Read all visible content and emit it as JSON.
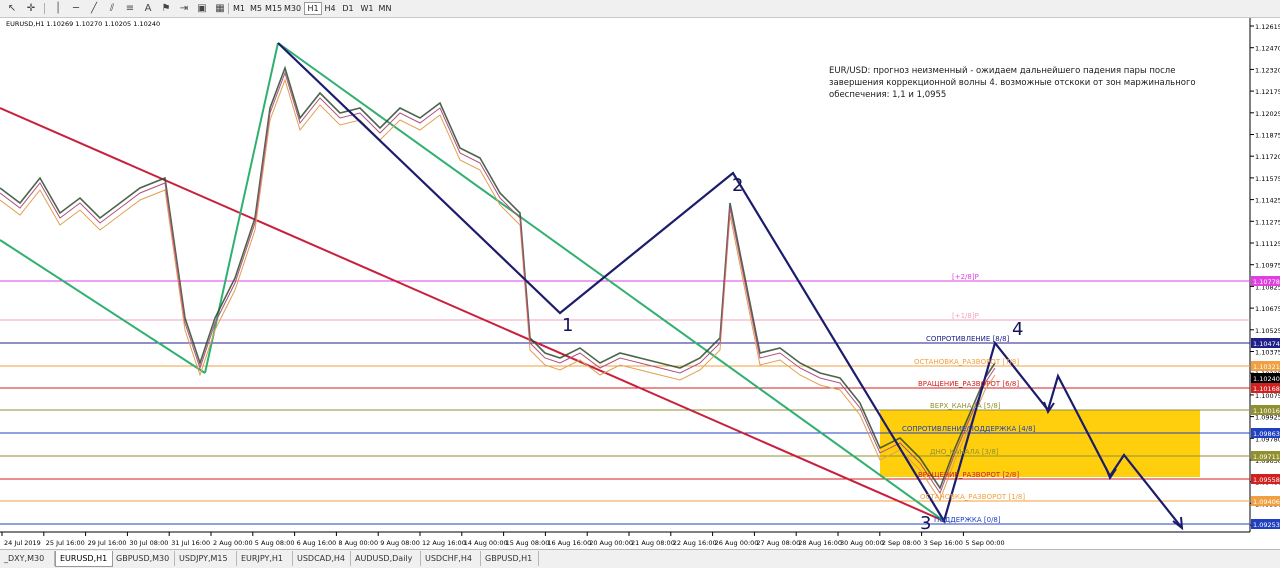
{
  "toolbar": {
    "timeframes": [
      "M1",
      "M5",
      "M15",
      "M30",
      "H1",
      "H4",
      "D1",
      "W1",
      "MN"
    ],
    "active_timeframe": "H1"
  },
  "chart": {
    "header": "EURUSD,H1  1.10269 1.10270 1.10205 1.10240",
    "annotation": "EUR/USD: прогноз неизменный - ожидаем дальнейшего падения пары после завершения коррекционной волны 4. возможные отскоки от зон маржинального обеспечения: 1,1 и 1,0955",
    "wave_labels": [
      "1",
      "2",
      "3",
      "4"
    ],
    "price_ticks": [
      "1.12615",
      "1.12470",
      "1.12320",
      "1.12175",
      "1.12025",
      "1.11875",
      "1.11720",
      "1.11575",
      "1.11425",
      "1.11275",
      "1.11125",
      "1.10975",
      "1.10825",
      "1.10675",
      "1.10525",
      "1.10375",
      "1.10225",
      "1.10075",
      "1.09925",
      "1.09780",
      "1.09630",
      "1.09480",
      "1.09330",
      "1.09180"
    ],
    "time_ticks": [
      "24 Jul 2019",
      "25 Jul 16:00",
      "29 Jul 16:00",
      "30 Jul 08:00",
      "31 Jul 16:00",
      "2 Aug 00:00",
      "5 Aug 08:00",
      "6 Aug 16:00",
      "8 Aug 00:00",
      "9 Aug 08:00",
      "12 Aug 16:00",
      "14 Aug 00:00",
      "15 Aug 08:00",
      "16 Aug 16:00",
      "20 Aug 00:00",
      "21 Aug 08:00",
      "22 Aug 16:00",
      "26 Aug 00:00",
      "27 Aug 08:00",
      "28 Aug 16:00",
      "30 Aug 00:00",
      "2 Sep 08:00",
      "3 Sep 16:00",
      "5 Sep 00:00"
    ],
    "level_badges": [
      {
        "text": "1.10778",
        "bg": "#e040e0"
      },
      {
        "text": "1.10474",
        "bg": "#20208a"
      },
      {
        "text": "1.10321",
        "bg": "#f0a040"
      },
      {
        "text": "1.10240",
        "bg": "#000000"
      },
      {
        "text": "1.10168",
        "bg": "#d02020"
      },
      {
        "text": "1.10016",
        "bg": "#909030"
      },
      {
        "text": "1.09863",
        "bg": "#2040c0"
      },
      {
        "text": "1.09711",
        "bg": "#909030"
      },
      {
        "text": "1.09558",
        "bg": "#d02020"
      },
      {
        "text": "1.09406",
        "bg": "#f0a040"
      },
      {
        "text": "1.09253",
        "bg": "#2040c0"
      }
    ],
    "murray_labels": [
      {
        "text": "[+2/8]P",
        "color": "#e040e0"
      },
      {
        "text": "[+1/8]P",
        "color": "#f4a0c0"
      },
      {
        "text": "СОПРОТИВЛЕНИЕ [8/8]",
        "color": "#20208a"
      },
      {
        "text": "ОСТАНОВКА_РАЗВОРОТ [7/8]",
        "color": "#f0a040"
      },
      {
        "text": "ВРАЩЕНИЕ_РАЗВОРОТ [6/8]",
        "color": "#d02020"
      },
      {
        "text": "ВЕРХ_КАНАЛА [5/8]",
        "color": "#909030"
      },
      {
        "text": "СОПРОТИВЛЕНИЕ/ПОДДЕРЖКА [4/8]",
        "color": "#2040c0"
      },
      {
        "text": "ДНО_КАНАЛА [3/8]",
        "color": "#909030"
      },
      {
        "text": "ВРАЩЕНИЕ_РАЗВОРОТ [2/8]",
        "color": "#d02020"
      },
      {
        "text": "ОСТАНОВКА_РАЗВОРОТ [1/8]",
        "color": "#f0a040"
      },
      {
        "text": "ПОДДЕРЖКА [0/8]",
        "color": "#2040c0"
      }
    ]
  },
  "tabs": [
    {
      "label": "_DXY,M30",
      "active": false
    },
    {
      "label": "EURUSD,H1",
      "active": true
    },
    {
      "label": "GBPUSD,M30",
      "active": false
    },
    {
      "label": "USDJPY,M15",
      "active": false
    },
    {
      "label": "EURJPY,H1",
      "active": false
    },
    {
      "label": "USDCAD,H4",
      "active": false
    },
    {
      "label": "AUDUSD,Daily",
      "active": false
    },
    {
      "label": "USDCHF,H4",
      "active": false
    },
    {
      "label": "GBPUSD,H1",
      "active": false
    }
  ]
}
